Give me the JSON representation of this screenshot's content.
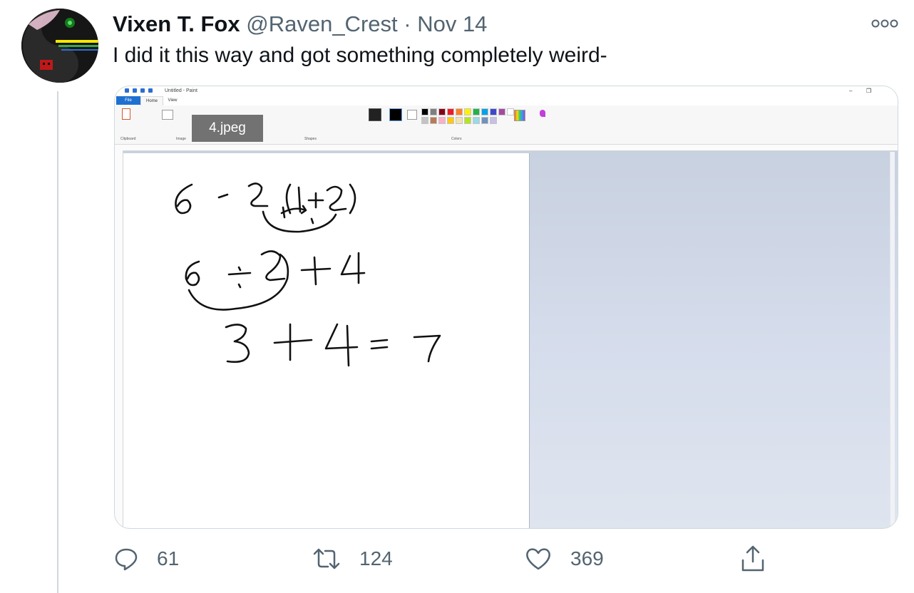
{
  "tweet": {
    "author_name": "Vixen T. Fox",
    "handle": "@Raven_Crest",
    "separator": "·",
    "date": "Nov 14",
    "text": "I did it this way and got something completely weird-",
    "avatar_icon": "yin-yang-avatar",
    "more_icon": "more-options-icon"
  },
  "media": {
    "overlay_label": "4.jpeg",
    "app": {
      "window_title": "Untitled - Paint",
      "tabs": [
        "File",
        "Home",
        "View"
      ],
      "ribbon_groups": [
        "Clipboard",
        "Image",
        "Tools",
        "Shapes",
        "Colors"
      ],
      "palette_colors": [
        "#000000",
        "#7f7f7f",
        "#880015",
        "#ed1c24",
        "#ff7f27",
        "#fff200",
        "#22b14c",
        "#00a2e8",
        "#3f48cc",
        "#a349a4",
        "#ffffff",
        "#c3c3c3",
        "#b97a57",
        "#ffaec9",
        "#ffc90e",
        "#efe4b0",
        "#b5e61d",
        "#99d9ea",
        "#7092be",
        "#c8bfe7"
      ],
      "handwritten_lines": [
        "6 ÷ 2 (1+2)",
        "6 ÷ 2 + 4",
        "3 + 4 = 7"
      ]
    }
  },
  "actions": {
    "reply_count": "61",
    "retweet_count": "124",
    "like_count": "369",
    "reply_icon": "reply-icon",
    "retweet_icon": "retweet-icon",
    "like_icon": "heart-icon",
    "share_icon": "share-icon"
  },
  "colors": {
    "primary_text": "#0f1419",
    "secondary_text": "#536471",
    "paint_file_tab": "#1f6fd0",
    "workspace": "#c8d1e0"
  }
}
